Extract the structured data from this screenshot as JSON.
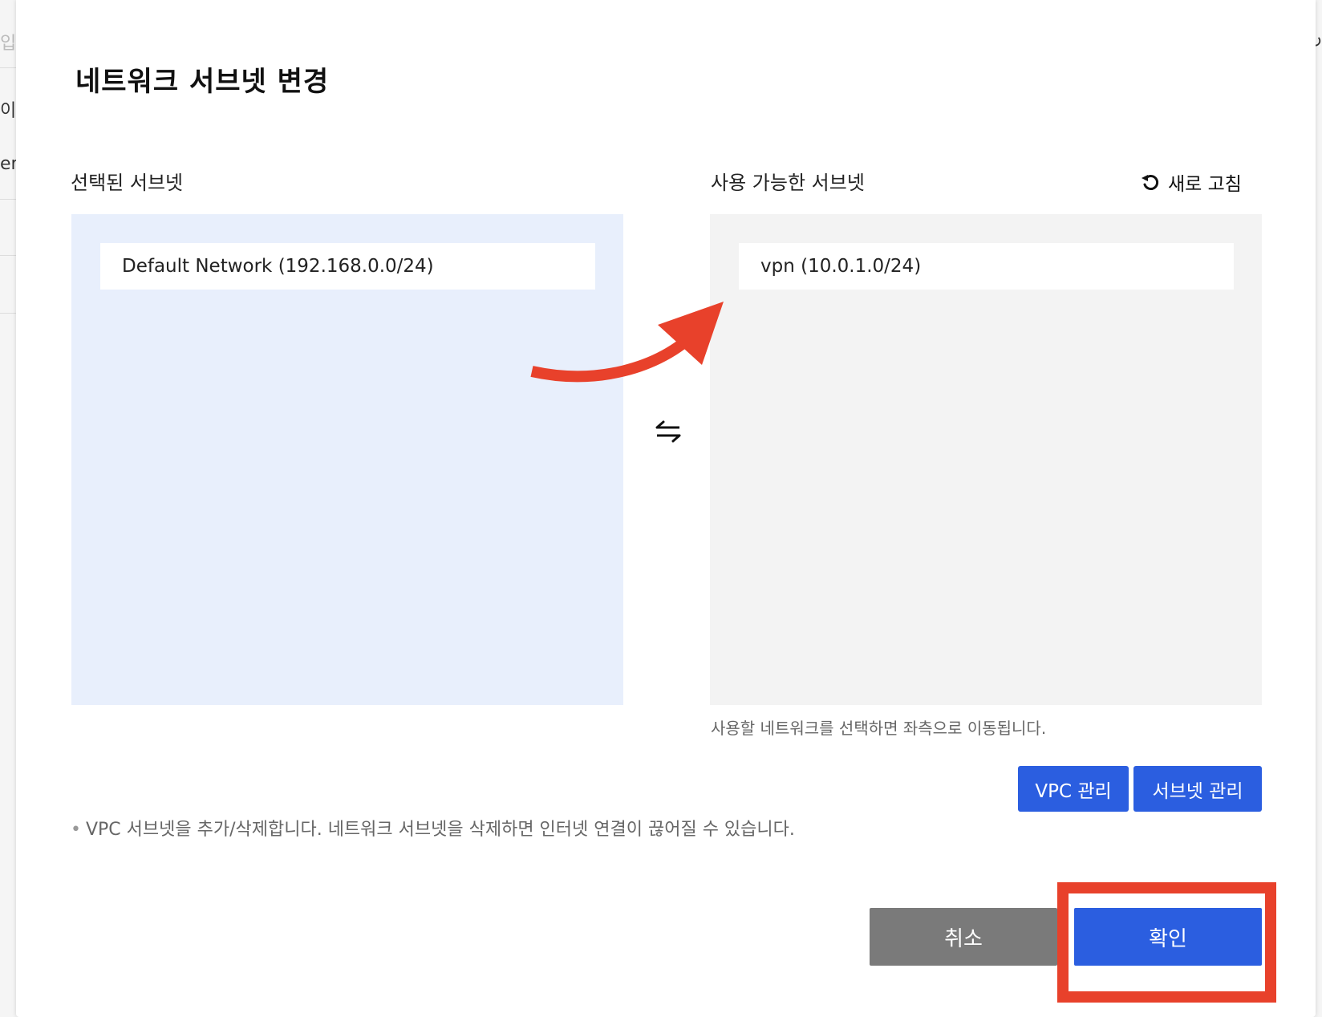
{
  "background": {
    "fragments": [
      "입",
      "이름",
      "em"
    ]
  },
  "modal": {
    "title": "네트워크 서브넷 변경",
    "selected_label": "선택된 서브넷",
    "available_label": "사용 가능한 서브넷",
    "refresh_label": "새로 고침",
    "selected_subnets": [
      "Default Network (192.168.0.0/24)"
    ],
    "available_subnets": [
      "vpn (10.0.1.0/24)"
    ],
    "hint": "사용할 네트워크를 선택하면 좌측으로 이동됩니다.",
    "vpc_manage_label": "VPC 관리",
    "subnet_manage_label": "서브넷 관리",
    "note_bullet": "•",
    "note": "VPC 서브넷을 추가/삭제합니다. 네트워크 서브넷을 삭제하면 인터넷 연결이 끊어질 수 있습니다.",
    "cancel_label": "취소",
    "confirm_label": "확인"
  },
  "colors": {
    "primary": "#2b5ee0",
    "cancel": "#7a7a7a",
    "selected_panel": "#e8effc",
    "available_panel": "#f3f3f3",
    "annotation": "#e8412b"
  },
  "icons": {
    "refresh": "refresh-icon",
    "swap": "swap-arrows-icon"
  }
}
